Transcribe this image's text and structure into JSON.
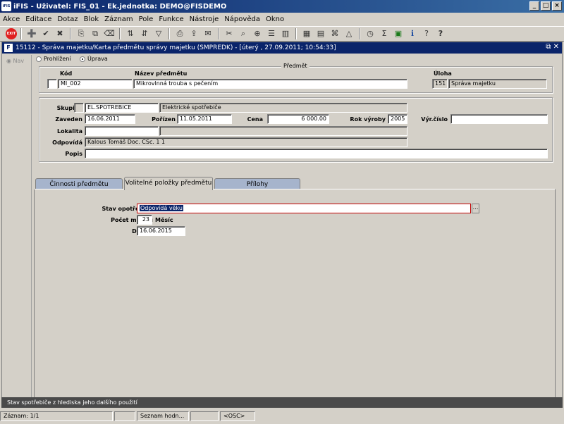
{
  "window": {
    "title": "iFIS - Uživatel: FIS_01 - Ek.jednotka: DEMO@FISDEMO",
    "app_icon": "iFIS"
  },
  "menu": [
    "Akce",
    "Editace",
    "Dotaz",
    "Blok",
    "Záznam",
    "Pole",
    "Funkce",
    "Nástroje",
    "Nápověda",
    "Okno"
  ],
  "toolbar": {
    "exit_label": "EXIT"
  },
  "form": {
    "title": "15112 - Správa majetku/Karta předmětu správy majetku (SMPREDK) - [úterý , 27.09.2011; 10:54:33]",
    "nav_label": "Nav",
    "mode": {
      "browse": "Prohlížení",
      "edit": "Úprava"
    },
    "predmet": {
      "legend": "Předmět",
      "kod_label": "Kód",
      "kod": "MI_002",
      "nazev_label": "Název předmětu",
      "nazev": "Mikrovlnná trouba s pečením",
      "uloha_label": "Úloha",
      "uloha_code": "151",
      "uloha_name": "Správa majetku"
    },
    "detail": {
      "skupina_label": "Skupina",
      "skupina_code": "EL.SPOTREBICE",
      "skupina_name": "Elektrické spotřebiče",
      "zaveden_label": "Zaveden",
      "zaveden": "16.06.2011",
      "porizen_label": "Pořízen",
      "porizen": "11.05.2011",
      "cena_label": "Cena",
      "cena": "6 000.00",
      "rok_label": "Rok výroby",
      "rok": "2005",
      "vyr_label": "Výr.číslo",
      "vyr": "",
      "lokalita_label": "Lokalita",
      "lokalita": "",
      "odpovida_label": "Odpovídá",
      "odpovida": "Kalous Tomáš Doc. CSc. 1 1",
      "popis_label": "Popis",
      "popis": ""
    },
    "tabs": [
      "Činnosti předmětu",
      "Volitelné položky předmětu",
      "Přílohy"
    ],
    "optional": {
      "stav_label": "Stav opotřebení",
      "stav": "Odpovídá věku",
      "pocet_label": "Počet měsíců",
      "pocet": "23",
      "unit": "Měsíc",
      "datum_label": "Datum",
      "datum": "16.06.2015"
    }
  },
  "hint": "Stav spotřebiče z hlediska jeho dalšího použití",
  "status": {
    "record": "Záznam: 1/1",
    "list": "Seznam hodn...",
    "osc": "<OSC>"
  }
}
